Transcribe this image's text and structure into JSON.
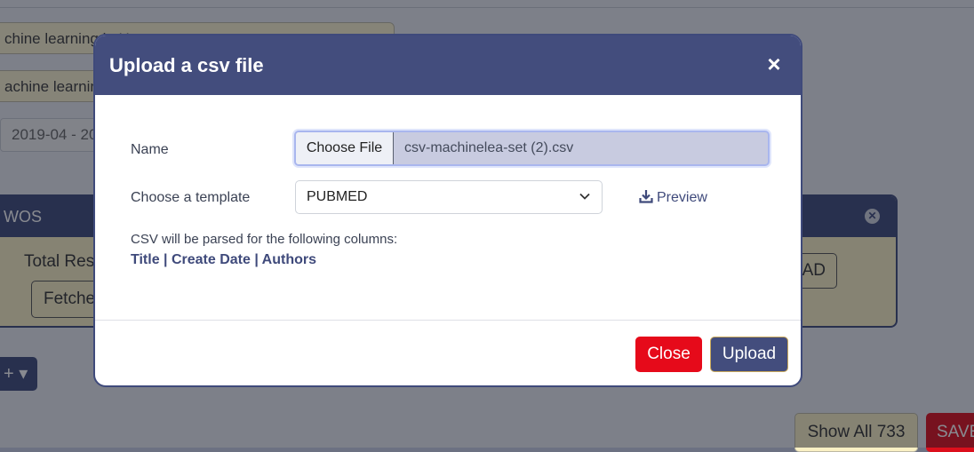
{
  "background": {
    "query1_text": "chine learning in H",
    "query2_text": "achine learning",
    "date_value": "2019-04 - 20",
    "card_title": "WOS",
    "total_label": "Total Res",
    "fetch_label": "Fetche",
    "load_label": "AD",
    "plus_label": "+ ▾",
    "show_all_label": "Show All 733",
    "save_label": "SAVE"
  },
  "modal": {
    "title": "Upload a csv file",
    "close_icon": "×",
    "name_label": "Name",
    "file_button": "Choose File",
    "file_name": "csv-machinelea-set (2).csv",
    "template_label": "Choose a template",
    "template_value": "PUBMED",
    "preview_label": "Preview",
    "parse_text": "CSV will be parsed for the following columns:",
    "columns_text": "Title | Create Date | Authors",
    "close_button": "Close",
    "upload_button": "Upload"
  },
  "colors": {
    "primary": "#434d7d",
    "danger": "#e60a1a",
    "card_bg": "#fbf1c4"
  },
  "icons": [
    "close-icon",
    "chevron-down-icon",
    "download-icon",
    "circle-x-icon"
  ]
}
